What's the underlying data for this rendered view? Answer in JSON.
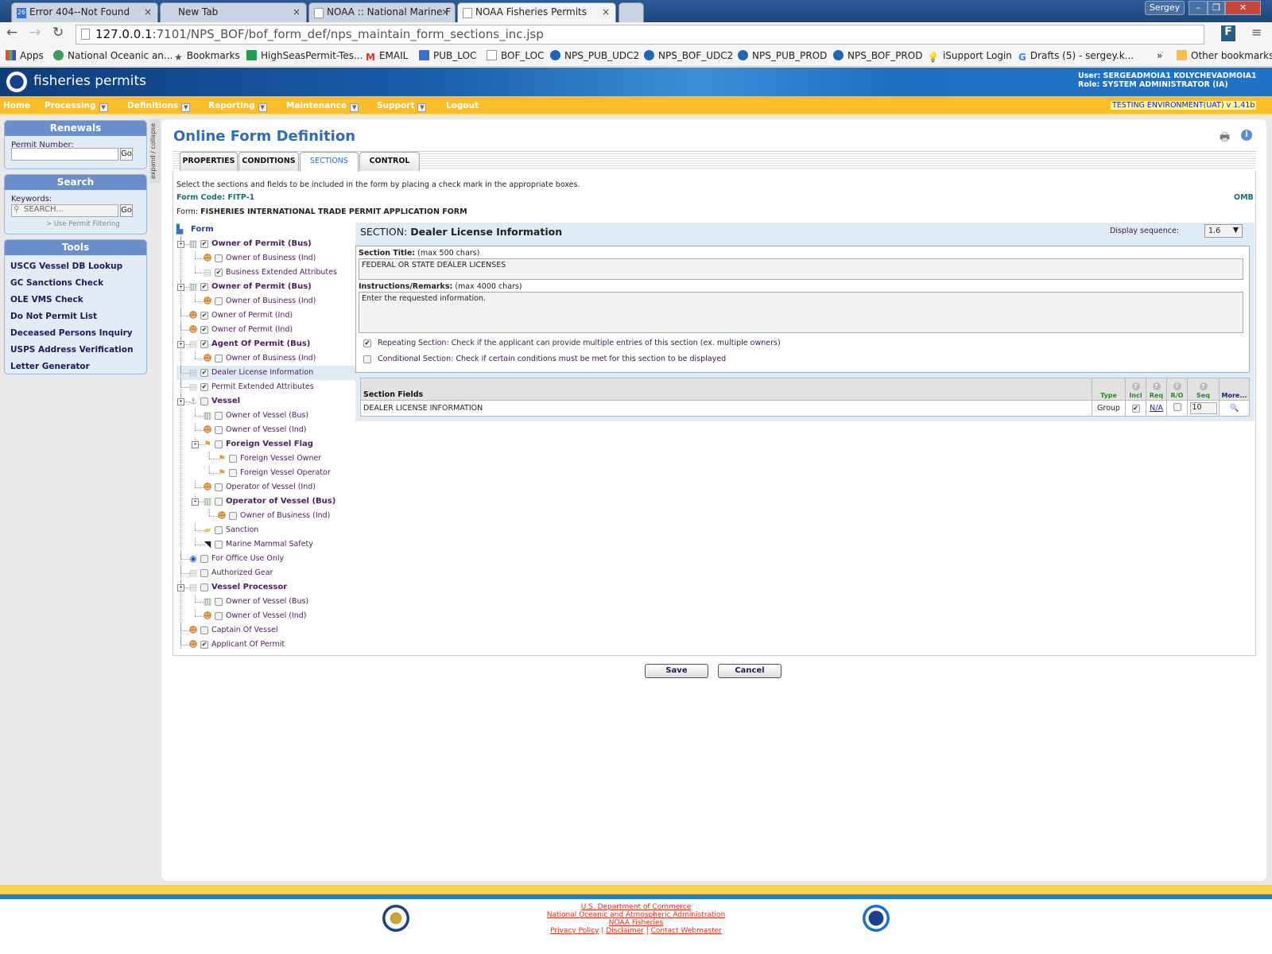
{
  "browser": {
    "tabs": [
      {
        "title": "Error 404--Not Found",
        "active": false
      },
      {
        "title": "New Tab",
        "active": false
      },
      {
        "title": "NOAA :: National Marine F",
        "active": false
      },
      {
        "title": "NOAA Fisheries Permits",
        "active": true
      }
    ],
    "profile": "Sergey",
    "url_host": "127.0.0.1",
    "url_path": ":7101/NPS_BOF/bof_form_def/nps_maintain_form_sections_inc.jsp",
    "bookmarks": [
      "Apps",
      "National Oceanic an...",
      "Bookmarks",
      "HighSeasPermit-Tes...",
      "EMAIL",
      "PUB_LOC",
      "BOF_LOC",
      "NPS_PUB_UDC2",
      "NPS_BOF_UDC2",
      "NPS_PUB_PROD",
      "NPS_BOF_PROD",
      "iSupport Login",
      "Drafts (5) - sergey.k...",
      "»",
      "Other bookmarks"
    ]
  },
  "header": {
    "site_name": "fisheries permits",
    "user_line": "User: SERGEADMOIA1 KOLYCHEVADMOIA1",
    "role_line": "Role: SYSTEM ADMINISTRATOR (IA)",
    "environment": "TESTING ENVIRONMENT(UAT) v 1.41b"
  },
  "nav": [
    "Home",
    "Processing",
    "Definitions",
    "Reporting",
    "Maintenance",
    "Support",
    "Logout"
  ],
  "sidebar": {
    "renewals": {
      "title": "Renewals",
      "label": "Permit Number:",
      "value": "",
      "go": "Go"
    },
    "search": {
      "title": "Search",
      "label": "Keywords:",
      "placeholder": "SEARCH...",
      "go": "Go",
      "filter_link": "> Use Permit Filtering"
    },
    "tools": {
      "title": "Tools",
      "items": [
        "USCG Vessel DB Lookup",
        "GC Sanctions Check",
        "OLE VMS Check",
        "Do Not Permit List",
        "Deceased Persons Inquiry",
        "USPS Address Verification",
        "Letter Generator"
      ]
    },
    "collapse_label": "expand / collapse"
  },
  "main": {
    "title": "Online Form Definition",
    "tabs": [
      "PROPERTIES",
      "CONDITIONS",
      "SECTIONS",
      "CONTROL"
    ],
    "active_tab": "SECTIONS",
    "instructions": "Select the sections and fields to be included in the form by placing a check mark in the appropriate boxes.",
    "form_code": "Form Code: FITP-1",
    "omb": "OMB",
    "form_label": "Form:",
    "form_name": "FISHERIES INTERNATIONAL TRADE PERMIT APPLICATION FORM",
    "tree_root": "Form",
    "tree": [
      {
        "label": "Owner of Permit (Bus)",
        "depth": 0,
        "bold": true,
        "checked": true,
        "icon": "building",
        "exp": true
      },
      {
        "label": "Owner of Business (Ind)",
        "depth": 1,
        "checked": false,
        "icon": "person"
      },
      {
        "label": "Business Extended Attributes",
        "depth": 1,
        "checked": true,
        "icon": "doc"
      },
      {
        "label": "Owner of Permit (Bus)",
        "depth": 0,
        "bold": true,
        "checked": true,
        "icon": "building",
        "exp": true
      },
      {
        "label": "Owner of Business (Ind)",
        "depth": 1,
        "checked": false,
        "icon": "person"
      },
      {
        "label": "Owner of Permit (Ind)",
        "depth": 0,
        "checked": true,
        "icon": "person"
      },
      {
        "label": "Owner of Permit (Ind)",
        "depth": 0,
        "checked": true,
        "icon": "person"
      },
      {
        "label": "Agent Of Permit (Bus)",
        "depth": 0,
        "bold": true,
        "checked": true,
        "icon": "doc",
        "exp": true
      },
      {
        "label": "Owner of Business (Ind)",
        "depth": 1,
        "checked": false,
        "icon": "person"
      },
      {
        "label": "Dealer License Information",
        "depth": 0,
        "checked": true,
        "icon": "doc",
        "selected": true
      },
      {
        "label": "Permit Extended Attributes",
        "depth": 0,
        "checked": true,
        "icon": "doc"
      },
      {
        "label": "Vessel",
        "depth": 0,
        "bold": true,
        "checked": false,
        "icon": "anchor",
        "exp": true
      },
      {
        "label": "Owner of Vessel (Bus)",
        "depth": 1,
        "checked": false,
        "icon": "building"
      },
      {
        "label": "Owner of Vessel (Ind)",
        "depth": 1,
        "checked": false,
        "icon": "person"
      },
      {
        "label": "Foreign Vessel Flag",
        "depth": 1,
        "bold": true,
        "checked": false,
        "icon": "flag",
        "exp": true
      },
      {
        "label": "Foreign Vessel Owner",
        "depth": 2,
        "checked": false,
        "icon": "flag"
      },
      {
        "label": "Foreign Vessel Operator",
        "depth": 2,
        "checked": false,
        "icon": "flag"
      },
      {
        "label": "Operator of Vessel (Ind)",
        "depth": 1,
        "checked": false,
        "icon": "person"
      },
      {
        "label": "Operator of Vessel (Bus)",
        "depth": 1,
        "bold": true,
        "checked": false,
        "icon": "building",
        "exp": true
      },
      {
        "label": "Owner of Business (Ind)",
        "depth": 2,
        "checked": false,
        "icon": "person"
      },
      {
        "label": "Sanction",
        "depth": 1,
        "checked": false,
        "icon": "folder"
      },
      {
        "label": "Marine Mammal Safety",
        "depth": 1,
        "checked": false,
        "icon": "whale"
      },
      {
        "label": "For Office Use Only",
        "depth": 0,
        "checked": false,
        "icon": "noaa"
      },
      {
        "label": "Authorized Gear",
        "depth": 0,
        "checked": false,
        "icon": "doc"
      },
      {
        "label": "Vessel Processor",
        "depth": 0,
        "bold": true,
        "checked": false,
        "icon": "doc",
        "exp": true
      },
      {
        "label": "Owner of Vessel (Bus)",
        "depth": 1,
        "checked": false,
        "icon": "building"
      },
      {
        "label": "Owner of Vessel (Ind)",
        "depth": 1,
        "checked": false,
        "icon": "person"
      },
      {
        "label": "Captain Of Vessel",
        "depth": 0,
        "checked": false,
        "icon": "person"
      },
      {
        "label": "Applicant Of Permit",
        "depth": 0,
        "checked": true,
        "icon": "person"
      }
    ],
    "section": {
      "prefix": "SECTION:",
      "name": "Dealer License Information",
      "display_sequence_label": "Display sequence:",
      "display_sequence": "1.6",
      "title_label": "Section Title:",
      "title_hint": "(max 500 chars)",
      "title_value": "FEDERAL OR STATE DEALER LICENSES",
      "remarks_label": "Instructions/Remarks:",
      "remarks_hint": "(max 4000 chars)",
      "remarks_value": "Enter the requested information.",
      "repeating": {
        "checked": true,
        "label": "Repeating Section: Check if the applicant can provide multiple entries of this section (ex. multiple owners)"
      },
      "conditional": {
        "checked": false,
        "label": "Conditional Section: Check if certain conditions must be met for this section to be displayed"
      }
    },
    "fields_table": {
      "headers": [
        "Section Fields",
        "Type",
        "Incl",
        "Req",
        "R/O",
        "Seq",
        "More..."
      ],
      "rows": [
        {
          "name": "DEALER LICENSE INFORMATION",
          "type": "Group",
          "incl": true,
          "req": "N/A",
          "ro": false,
          "seq": "10"
        }
      ]
    },
    "save": "Save",
    "cancel": "Cancel"
  },
  "footer": {
    "links": [
      "U.S. Department of Commerce",
      "National Oceanic and Atmospheric Administration",
      "NOAA Fisheries"
    ],
    "bottom_links": [
      "Privacy Policy",
      "Disclaimer",
      "Contact Webmaster"
    ]
  }
}
